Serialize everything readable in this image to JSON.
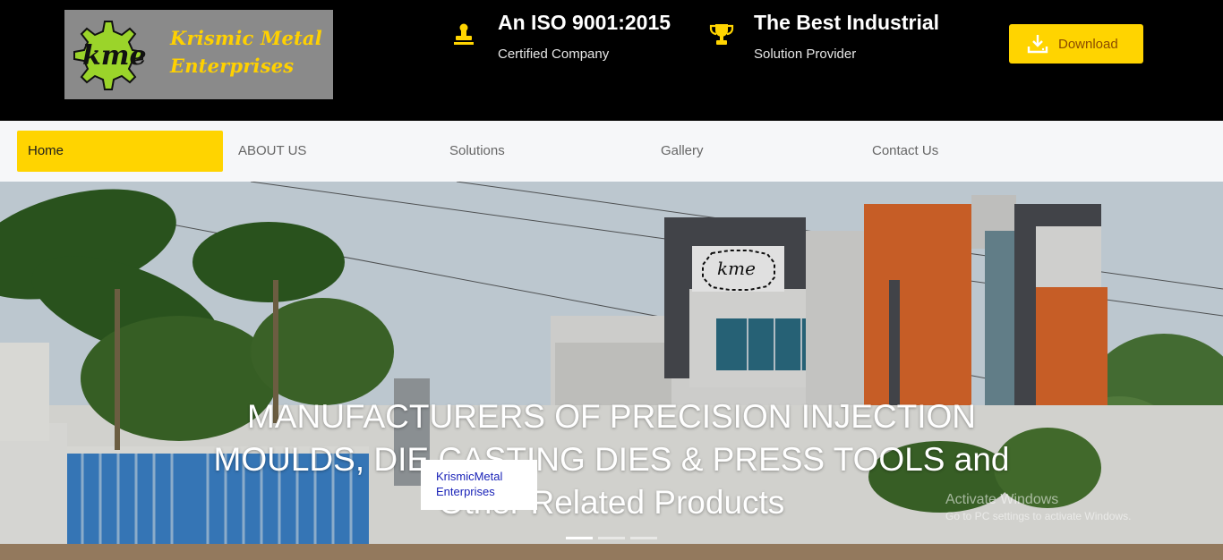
{
  "brand": {
    "logo_mark": "kme",
    "name_line1": "Krismic Metal",
    "name_line2": "Enterprises",
    "accent_color": "#ffd400"
  },
  "header": {
    "iso": {
      "icon": "stamp-icon",
      "title": "An ISO 9001:2015",
      "subtitle": "Certified Company"
    },
    "best": {
      "icon": "trophy-icon",
      "title": "The Best Industrial",
      "subtitle": "Solution Provider"
    },
    "download": {
      "icon": "download-icon",
      "label": "Download"
    }
  },
  "nav": {
    "items": [
      {
        "label": "Home",
        "active": true
      },
      {
        "label": "ABOUT US",
        "active": false
      },
      {
        "label": "Solutions",
        "active": false
      },
      {
        "label": "Gallery",
        "active": false
      },
      {
        "label": "Contact Us",
        "active": false
      }
    ]
  },
  "hero": {
    "building_sign": "kme",
    "headline": "MANUFACTURERS OF PRECISION INJECTION MOULDS, DIE CASTING DIES & PRESS TOOLS and Other Related Products",
    "caption_line1": "KrismicMetal",
    "caption_line2": "Enterprises",
    "watermark_line1": "Activate Windows",
    "watermark_line2": "Go to PC settings to activate Windows.",
    "slide_count": 3,
    "active_slide": 1
  }
}
